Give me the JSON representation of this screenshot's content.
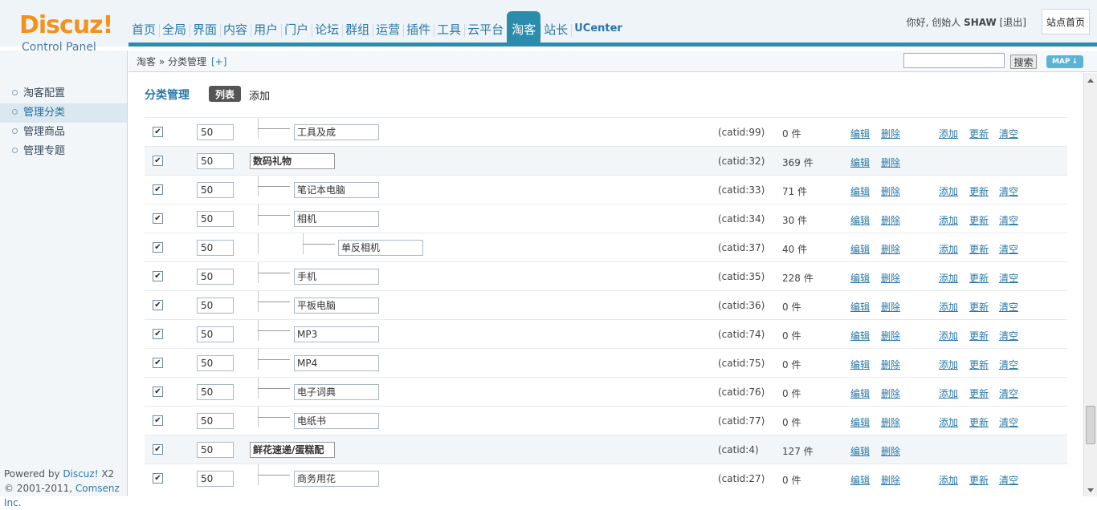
{
  "logo": {
    "brand": "Discuz!",
    "subtitle": "Control Panel"
  },
  "nav": {
    "items": [
      "首页",
      "全局",
      "界面",
      "内容",
      "用户",
      "门户",
      "论坛",
      "群组",
      "运营",
      "插件",
      "工具",
      "云平台",
      "淘客",
      "站长",
      "UCenter"
    ],
    "active": "淘客"
  },
  "user": {
    "greeting": "你好, 创始人",
    "name": "SHAW",
    "logout": "[退出]"
  },
  "site_home_button": "站点首页",
  "breadcrumb": {
    "path": "淘客 » 分类管理",
    "plus": "[+]"
  },
  "search": {
    "value": "",
    "button": "搜索",
    "map_button": "MAP"
  },
  "sidebar": {
    "items": [
      "淘客配置",
      "管理分类",
      "管理商品",
      "管理专题"
    ],
    "active": "管理分类",
    "footer_line1_prefix": "Powered by ",
    "footer_line1_link": "Discuz!",
    "footer_line1_suffix": " X2",
    "footer_line2_prefix": "© 2001-2011, ",
    "footer_line2_link": "Comsenz Inc."
  },
  "page": {
    "title": "分类管理",
    "tab_list": "列表",
    "tab_add": "添加"
  },
  "actions": {
    "edit": "编辑",
    "delete": "删除",
    "add": "添加",
    "update": "更新",
    "clear": "清空"
  },
  "rows": [
    {
      "level": 1,
      "order": "50",
      "name": "工具及成",
      "catid": "(catid:99)",
      "count": "0 件",
      "checked": true
    },
    {
      "level": 0,
      "order": "50",
      "name": "数码礼物",
      "catid": "(catid:32)",
      "count": "369 件",
      "checked": true
    },
    {
      "level": 1,
      "order": "50",
      "name": "笔记本电脑",
      "catid": "(catid:33)",
      "count": "71 件",
      "checked": true
    },
    {
      "level": 1,
      "order": "50",
      "name": "相机",
      "catid": "(catid:34)",
      "count": "30 件",
      "checked": true
    },
    {
      "level": 2,
      "order": "50",
      "name": "单反相机",
      "catid": "(catid:37)",
      "count": "40 件",
      "checked": true
    },
    {
      "level": 1,
      "order": "50",
      "name": "手机",
      "catid": "(catid:35)",
      "count": "228 件",
      "checked": true
    },
    {
      "level": 1,
      "order": "50",
      "name": "平板电脑",
      "catid": "(catid:36)",
      "count": "0 件",
      "checked": true
    },
    {
      "level": 1,
      "order": "50",
      "name": "MP3",
      "catid": "(catid:74)",
      "count": "0 件",
      "checked": true
    },
    {
      "level": 1,
      "order": "50",
      "name": "MP4",
      "catid": "(catid:75)",
      "count": "0 件",
      "checked": true
    },
    {
      "level": 1,
      "order": "50",
      "name": "电子词典",
      "catid": "(catid:76)",
      "count": "0 件",
      "checked": true
    },
    {
      "level": 1,
      "order": "50",
      "name": "电纸书",
      "catid": "(catid:77)",
      "count": "0 件",
      "checked": true
    },
    {
      "level": 0,
      "order": "50",
      "name": "鲜花速递/蛋糕配",
      "catid": "(catid:4)",
      "count": "127 件",
      "checked": true
    },
    {
      "level": 1,
      "order": "50",
      "name": "商务用花",
      "catid": "(catid:27)",
      "count": "0 件",
      "checked": true
    }
  ],
  "colors": {
    "accent": "#2b8cab",
    "link": "#2a78a8",
    "logo": "#f3921b"
  }
}
